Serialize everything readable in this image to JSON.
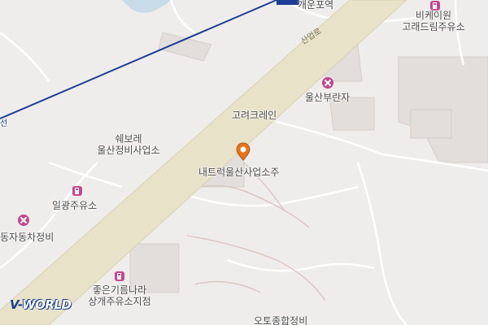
{
  "map": {
    "road_label": "산업로",
    "colors": {
      "background": "#efedeb",
      "road": "#e8e2c8",
      "road_edge": "#d8d1b2",
      "rail": "#1d3d96",
      "water": "#c7dce8",
      "building": "#d9d5d1",
      "poi_gas": "#c3478d",
      "poi_repair": "#c3478d",
      "marker": "#e8731a"
    },
    "pois": [
      {
        "id": "gaewon",
        "label": "개운포역",
        "icon": "station-icon"
      },
      {
        "id": "bk",
        "label_line1": "비케이원",
        "label_line2": "고래드림주유소",
        "icon": "gas-station-icon"
      },
      {
        "id": "ulsan-buranja",
        "label": "울산부란자",
        "icon": "repair-shop-icon"
      },
      {
        "id": "goryeo",
        "label": "고려크레인",
        "icon": ""
      },
      {
        "id": "swebore",
        "label_line1": "쉐보레",
        "label_line2": "울산정비사업소",
        "icon": ""
      },
      {
        "id": "natrak",
        "label": "내트럭울산사업소주",
        "icon": "location-pin-icon"
      },
      {
        "id": "ilgwang",
        "label": "일광주유소",
        "icon": "gas-station-icon"
      },
      {
        "id": "dongja",
        "label": "동자동차정비",
        "icon": "repair-shop-icon"
      },
      {
        "id": "joeun",
        "label_line1": "좋은기름나라",
        "label_line2": "상개주유소지점",
        "icon": "gas-station-icon"
      },
      {
        "id": "auto",
        "label": "오토종합정비",
        "icon": ""
      }
    ],
    "rail_label": "선",
    "logo": {
      "part1": "V-",
      "part2": "WORLD"
    }
  }
}
